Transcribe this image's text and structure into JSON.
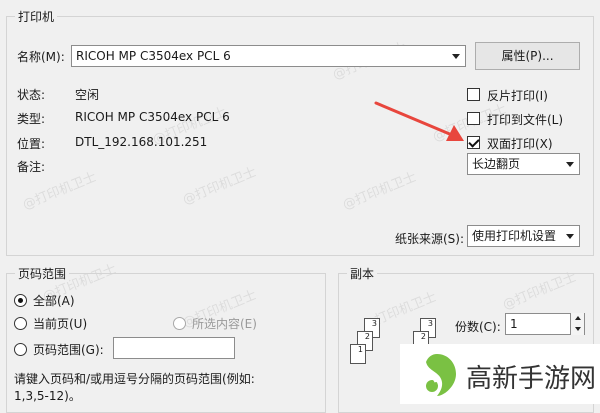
{
  "printer": {
    "section_label": "打印机",
    "name_label": "名称(M):",
    "name_value": "RICOH MP C3504ex PCL 6",
    "properties_button": "属性(P)...",
    "status_label": "状态:",
    "status_value": "空闲",
    "type_label": "类型:",
    "type_value": "RICOH MP C3504ex PCL 6",
    "location_label": "位置:",
    "location_value": "DTL_192.168.101.251",
    "comment_label": "备注:",
    "options": {
      "reverse_print": {
        "label": "反片打印(I)",
        "checked": false
      },
      "print_to_file": {
        "label": "打印到文件(L)",
        "checked": false
      },
      "duplex": {
        "label": "双面打印(X)",
        "checked": true
      }
    },
    "duplex_mode_value": "长边翻页",
    "paper_source_label": "纸张来源(S):",
    "paper_source_value": "使用打印机设置"
  },
  "page_range": {
    "section_label": "页码范围",
    "all_label": "全部(A)",
    "current_page_label": "当前页(U)",
    "selection_label": "所选内容(E)",
    "pages_label": "页码范围(G):",
    "pages_value": "",
    "hint": "请键入页码和/或用逗号分隔的页码范围(例如:",
    "hint_example": "1,3,5-12)。",
    "selected": "all"
  },
  "copies": {
    "section_label": "副本",
    "count_label": "份数(C):",
    "count_value": "1",
    "collate_pages": [
      "1",
      "2",
      "3"
    ]
  },
  "watermark": "@打印机卫士",
  "brand": {
    "name": "高新手游网",
    "accent": "#7ac143"
  },
  "annotation_arrow_color": "#e8463d"
}
